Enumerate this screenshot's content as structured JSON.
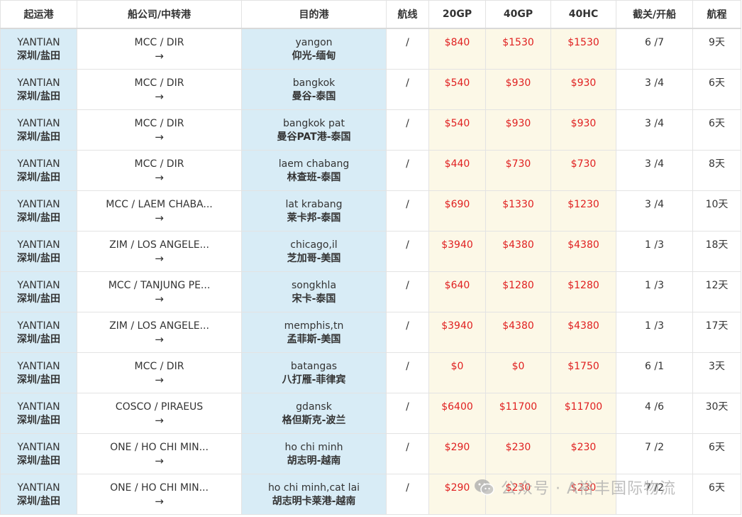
{
  "table": {
    "headers": {
      "origin": "起运港",
      "carrier": "船公司/中转港",
      "destination": "目的港",
      "route": "航线",
      "gp20": "20GP",
      "gp40": "40GP",
      "hc40": "40HC",
      "cutoff": "截关/开船",
      "transit": "航程"
    },
    "arrow": "→",
    "rows": [
      {
        "origin_en": "YANTIAN",
        "origin_cn": "深圳/盐田",
        "carrier": "MCC / DIR",
        "dest_en": "yangon",
        "dest_cn": "仰光-缅甸",
        "route": "/",
        "gp20": "$840",
        "gp40": "$1530",
        "hc40": "$1530",
        "cutoff": "6 /7",
        "transit": "9天"
      },
      {
        "origin_en": "YANTIAN",
        "origin_cn": "深圳/盐田",
        "carrier": "MCC / DIR",
        "dest_en": "bangkok",
        "dest_cn": "曼谷-泰国",
        "route": "/",
        "gp20": "$540",
        "gp40": "$930",
        "hc40": "$930",
        "cutoff": "3 /4",
        "transit": "6天"
      },
      {
        "origin_en": "YANTIAN",
        "origin_cn": "深圳/盐田",
        "carrier": "MCC / DIR",
        "dest_en": "bangkok pat",
        "dest_cn": "曼谷PAT港-泰国",
        "route": "/",
        "gp20": "$540",
        "gp40": "$930",
        "hc40": "$930",
        "cutoff": "3 /4",
        "transit": "6天"
      },
      {
        "origin_en": "YANTIAN",
        "origin_cn": "深圳/盐田",
        "carrier": "MCC / DIR",
        "dest_en": "laem chabang",
        "dest_cn": "林查班-泰国",
        "route": "/",
        "gp20": "$440",
        "gp40": "$730",
        "hc40": "$730",
        "cutoff": "3 /4",
        "transit": "8天"
      },
      {
        "origin_en": "YANTIAN",
        "origin_cn": "深圳/盐田",
        "carrier": "MCC / LAEM CHABA...",
        "dest_en": "lat krabang",
        "dest_cn": "莱卡邦-泰国",
        "route": "/",
        "gp20": "$690",
        "gp40": "$1330",
        "hc40": "$1230",
        "cutoff": "3 /4",
        "transit": "10天"
      },
      {
        "origin_en": "YANTIAN",
        "origin_cn": "深圳/盐田",
        "carrier": "ZIM / LOS ANGELE...",
        "dest_en": "chicago,il",
        "dest_cn": "芝加哥-美国",
        "route": "/",
        "gp20": "$3940",
        "gp40": "$4380",
        "hc40": "$4380",
        "cutoff": "1 /3",
        "transit": "18天"
      },
      {
        "origin_en": "YANTIAN",
        "origin_cn": "深圳/盐田",
        "carrier": "MCC / TANJUNG PE...",
        "dest_en": "songkhla",
        "dest_cn": "宋卡-泰国",
        "route": "/",
        "gp20": "$640",
        "gp40": "$1280",
        "hc40": "$1280",
        "cutoff": "1 /3",
        "transit": "12天"
      },
      {
        "origin_en": "YANTIAN",
        "origin_cn": "深圳/盐田",
        "carrier": "ZIM / LOS ANGELE...",
        "dest_en": "memphis,tn",
        "dest_cn": "孟菲斯-美国",
        "route": "/",
        "gp20": "$3940",
        "gp40": "$4380",
        "hc40": "$4380",
        "cutoff": "1 /3",
        "transit": "17天"
      },
      {
        "origin_en": "YANTIAN",
        "origin_cn": "深圳/盐田",
        "carrier": "MCC / DIR",
        "dest_en": "batangas",
        "dest_cn": "八打雁-菲律宾",
        "route": "/",
        "gp20": "$0",
        "gp40": "$0",
        "hc40": "$1750",
        "cutoff": "6 /1",
        "transit": "3天"
      },
      {
        "origin_en": "YANTIAN",
        "origin_cn": "深圳/盐田",
        "carrier": "COSCO / PIRAEUS",
        "dest_en": "gdansk",
        "dest_cn": "格但斯克-波兰",
        "route": "/",
        "gp20": "$6400",
        "gp40": "$11700",
        "hc40": "$11700",
        "cutoff": "4 /6",
        "transit": "30天"
      },
      {
        "origin_en": "YANTIAN",
        "origin_cn": "深圳/盐田",
        "carrier": "ONE / HO CHI MIN...",
        "dest_en": "ho chi minh",
        "dest_cn": "胡志明-越南",
        "route": "/",
        "gp20": "$290",
        "gp40": "$230",
        "hc40": "$230",
        "cutoff": "7 /2",
        "transit": "6天"
      },
      {
        "origin_en": "YANTIAN",
        "origin_cn": "深圳/盐田",
        "carrier": "ONE / HO CHI MIN...",
        "dest_en": "ho chi minh,cat lai",
        "dest_cn": "胡志明卡莱港-越南",
        "route": "/",
        "gp20": "$290",
        "gp40": "$230",
        "hc40": "$230",
        "cutoff": "7 /2",
        "transit": "6天"
      }
    ]
  },
  "watermark": {
    "text": "公众号 · A裕丰国际物流",
    "icon": "wechat-icon"
  },
  "colors": {
    "origin_bg": "#d8ecf6",
    "price_bg": "#fcf8e7",
    "price_text": "#e02020"
  }
}
